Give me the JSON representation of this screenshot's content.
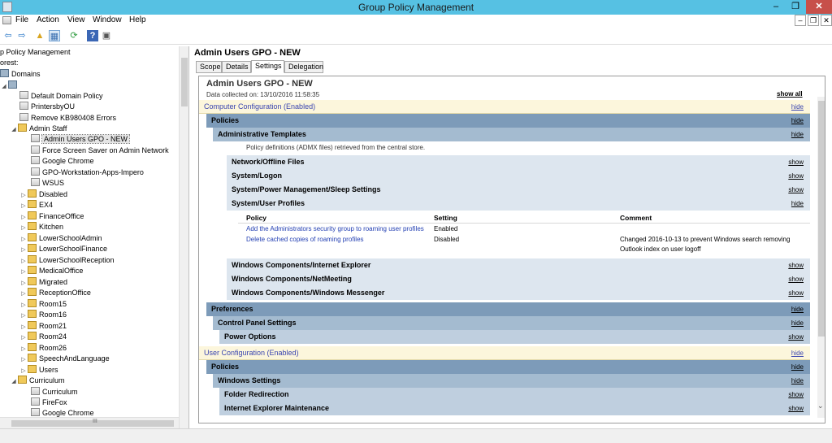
{
  "window": {
    "title": "Group Policy Management",
    "min": "–",
    "max": "❐",
    "close": "✕"
  },
  "menu": {
    "file": "File",
    "action": "Action",
    "view": "View",
    "window": "Window",
    "help": "Help"
  },
  "mdi": {
    "min": "–",
    "restore": "❐",
    "close": "✕"
  },
  "toolbar": {
    "back": "⇦",
    "forward": "⇨",
    "up": "▲",
    "show_hide": "▦",
    "refresh": "⟳",
    "help": "?",
    "console": "▣"
  },
  "tree": {
    "root": "p Policy Management",
    "forest": "orest:",
    "domains": "Domains",
    "items": [
      {
        "label": "Default Domain Policy"
      },
      {
        "label": "PrintersbyOU"
      },
      {
        "label": "Remove KB980408 Errors"
      },
      {
        "label": "Admin Staff"
      },
      {
        "label": "Admin Users GPO - NEW"
      },
      {
        "label": "Force Screen Saver on Admin Network"
      },
      {
        "label": "Google Chrome"
      },
      {
        "label": "GPO-Workstation-Apps-Impero"
      },
      {
        "label": "WSUS"
      },
      {
        "label": "Disabled"
      },
      {
        "label": "EX4"
      },
      {
        "label": "FinanceOffice"
      },
      {
        "label": "Kitchen"
      },
      {
        "label": "LowerSchoolAdmin"
      },
      {
        "label": "LowerSchoolFinance"
      },
      {
        "label": "LowerSchoolReception"
      },
      {
        "label": "MedicalOffice"
      },
      {
        "label": "Migrated"
      },
      {
        "label": "ReceptionOffice"
      },
      {
        "label": "Room15"
      },
      {
        "label": "Room16"
      },
      {
        "label": "Room21"
      },
      {
        "label": "Room24"
      },
      {
        "label": "Room26"
      },
      {
        "label": "SpeechAndLanguage"
      },
      {
        "label": "Users"
      },
      {
        "label": "Curriculum"
      },
      {
        "label": "Curriculum"
      },
      {
        "label": "FireFox"
      },
      {
        "label": "Google Chrome"
      }
    ],
    "hscroll_mark": "III"
  },
  "detail": {
    "title": "Admin Users GPO - NEW",
    "tabs": [
      "Scope",
      "Details",
      "Settings",
      "Delegation"
    ],
    "active_tab": "Settings"
  },
  "report": {
    "title": "Admin Users GPO - NEW",
    "collected": "Data collected on: 13/10/2016 11:58:35",
    "show_all": "show all",
    "computer_config": "Computer Configuration (Enabled)",
    "policies": "Policies",
    "admin_templates": "Administrative Templates",
    "admx_note": "Policy definitions (ADMX files) retrieved from the central store.",
    "network_offline": "Network/Offline Files",
    "system_logon": "System/Logon",
    "system_power": "System/Power Management/Sleep Settings",
    "system_user_profiles": "System/User Profiles",
    "table": {
      "headers": {
        "policy": "Policy",
        "setting": "Setting",
        "comment": "Comment"
      },
      "rows": [
        {
          "policy": "Add the Administrators security group to roaming user profiles",
          "setting": "Enabled",
          "comment": ""
        },
        {
          "policy": "Delete cached copies of roaming profiles",
          "setting": "Disabled",
          "comment": "Changed 2016-10-13 to prevent Windows search removing",
          "comment2": "Outlook index on user logoff"
        }
      ]
    },
    "wc_ie": "Windows Components/Internet Explorer",
    "wc_netmeeting": "Windows Components/NetMeeting",
    "wc_messenger": "Windows Components/Windows Messenger",
    "preferences": "Preferences",
    "control_panel": "Control Panel Settings",
    "power_options": "Power Options",
    "user_config": "User Configuration (Enabled)",
    "policies2": "Policies",
    "windows_settings": "Windows Settings",
    "folder_redirection": "Folder Redirection",
    "ie_maintenance": "Internet Explorer Maintenance",
    "hide": "hide",
    "show": "show"
  }
}
